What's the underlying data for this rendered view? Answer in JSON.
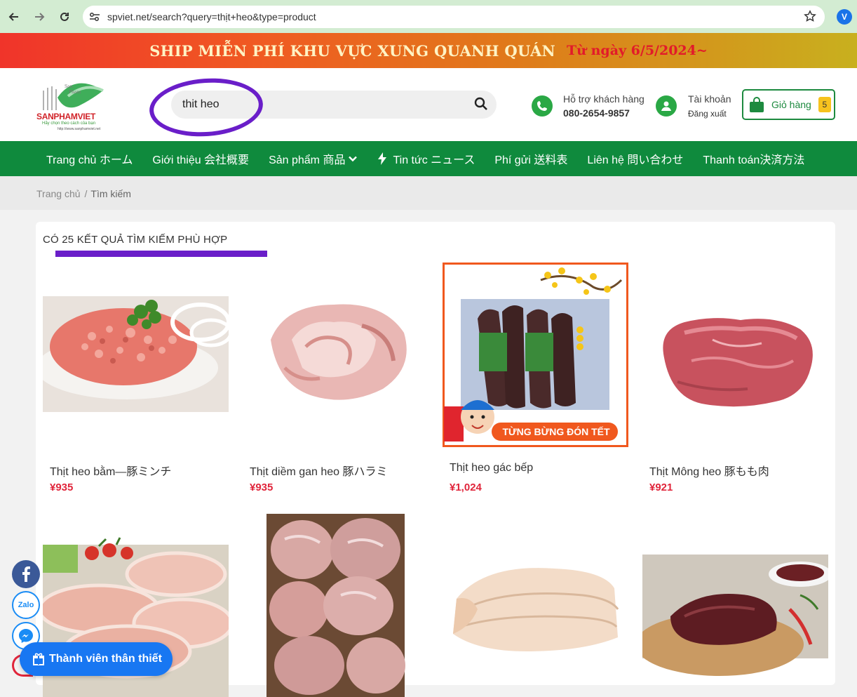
{
  "browser": {
    "url": "spviet.net/search?query=thịt+heo&type=product",
    "profile_initial": "V"
  },
  "promo": {
    "main_text": "SHIP MIỄN PHÍ KHU VỰC XUNG QUANH QUÁN",
    "date_text": "Từ ngày 6/5/2024~"
  },
  "header": {
    "logo": {
      "brand": "SANPHAMVIET",
      "slogan": "Hãy chọn theo cách của bạn",
      "url": "http://www.sanphamviet.net"
    },
    "search": {
      "value": "thit heo",
      "placeholder": ""
    },
    "support": {
      "label": "Hỗ trợ khách hàng",
      "phone": "080-2654-9857"
    },
    "account": {
      "label": "Tài khoản",
      "logout": "Đăng xuất"
    },
    "cart": {
      "label": "Giỏ hàng",
      "count": "5"
    }
  },
  "nav": {
    "items": [
      {
        "label": "Trang chủ ホーム"
      },
      {
        "label": "Giới thiệu 会社概要"
      },
      {
        "label": "Sản phẩm 商品"
      },
      {
        "label": "Tin tức ニュース"
      },
      {
        "label": "Phí gửi 送料表"
      },
      {
        "label": "Liên hệ 問い合わせ"
      },
      {
        "label": "Thanh toán決済方法"
      }
    ]
  },
  "breadcrumb": {
    "home": "Trang chủ",
    "separator": "/",
    "current": "Tìm kiếm"
  },
  "results": {
    "title": "CÓ 25 KẾT QUẢ TÌM KIẾM PHÙ HỢP",
    "products": [
      {
        "name": "Thịt heo bằm—豚ミンチ",
        "price": "¥935"
      },
      {
        "name": "Thịt diềm gan heo 豚ハラミ",
        "price": "¥935"
      },
      {
        "name": "Thịt heo gác bếp",
        "price": "¥1,024",
        "badge": "TỪNG BỪNG ĐÓN TẾT"
      },
      {
        "name": "Thịt Mông heo 豚もも肉",
        "price": "¥921"
      }
    ]
  },
  "floating": {
    "member_button": "Thành viên thân thiết",
    "zalo_label": "Zalo"
  },
  "colors": {
    "brand_green": "#0f8a3d",
    "price_red": "#e0253b",
    "annotation_purple": "#6a1ec9",
    "messenger_blue": "#1877f2"
  }
}
